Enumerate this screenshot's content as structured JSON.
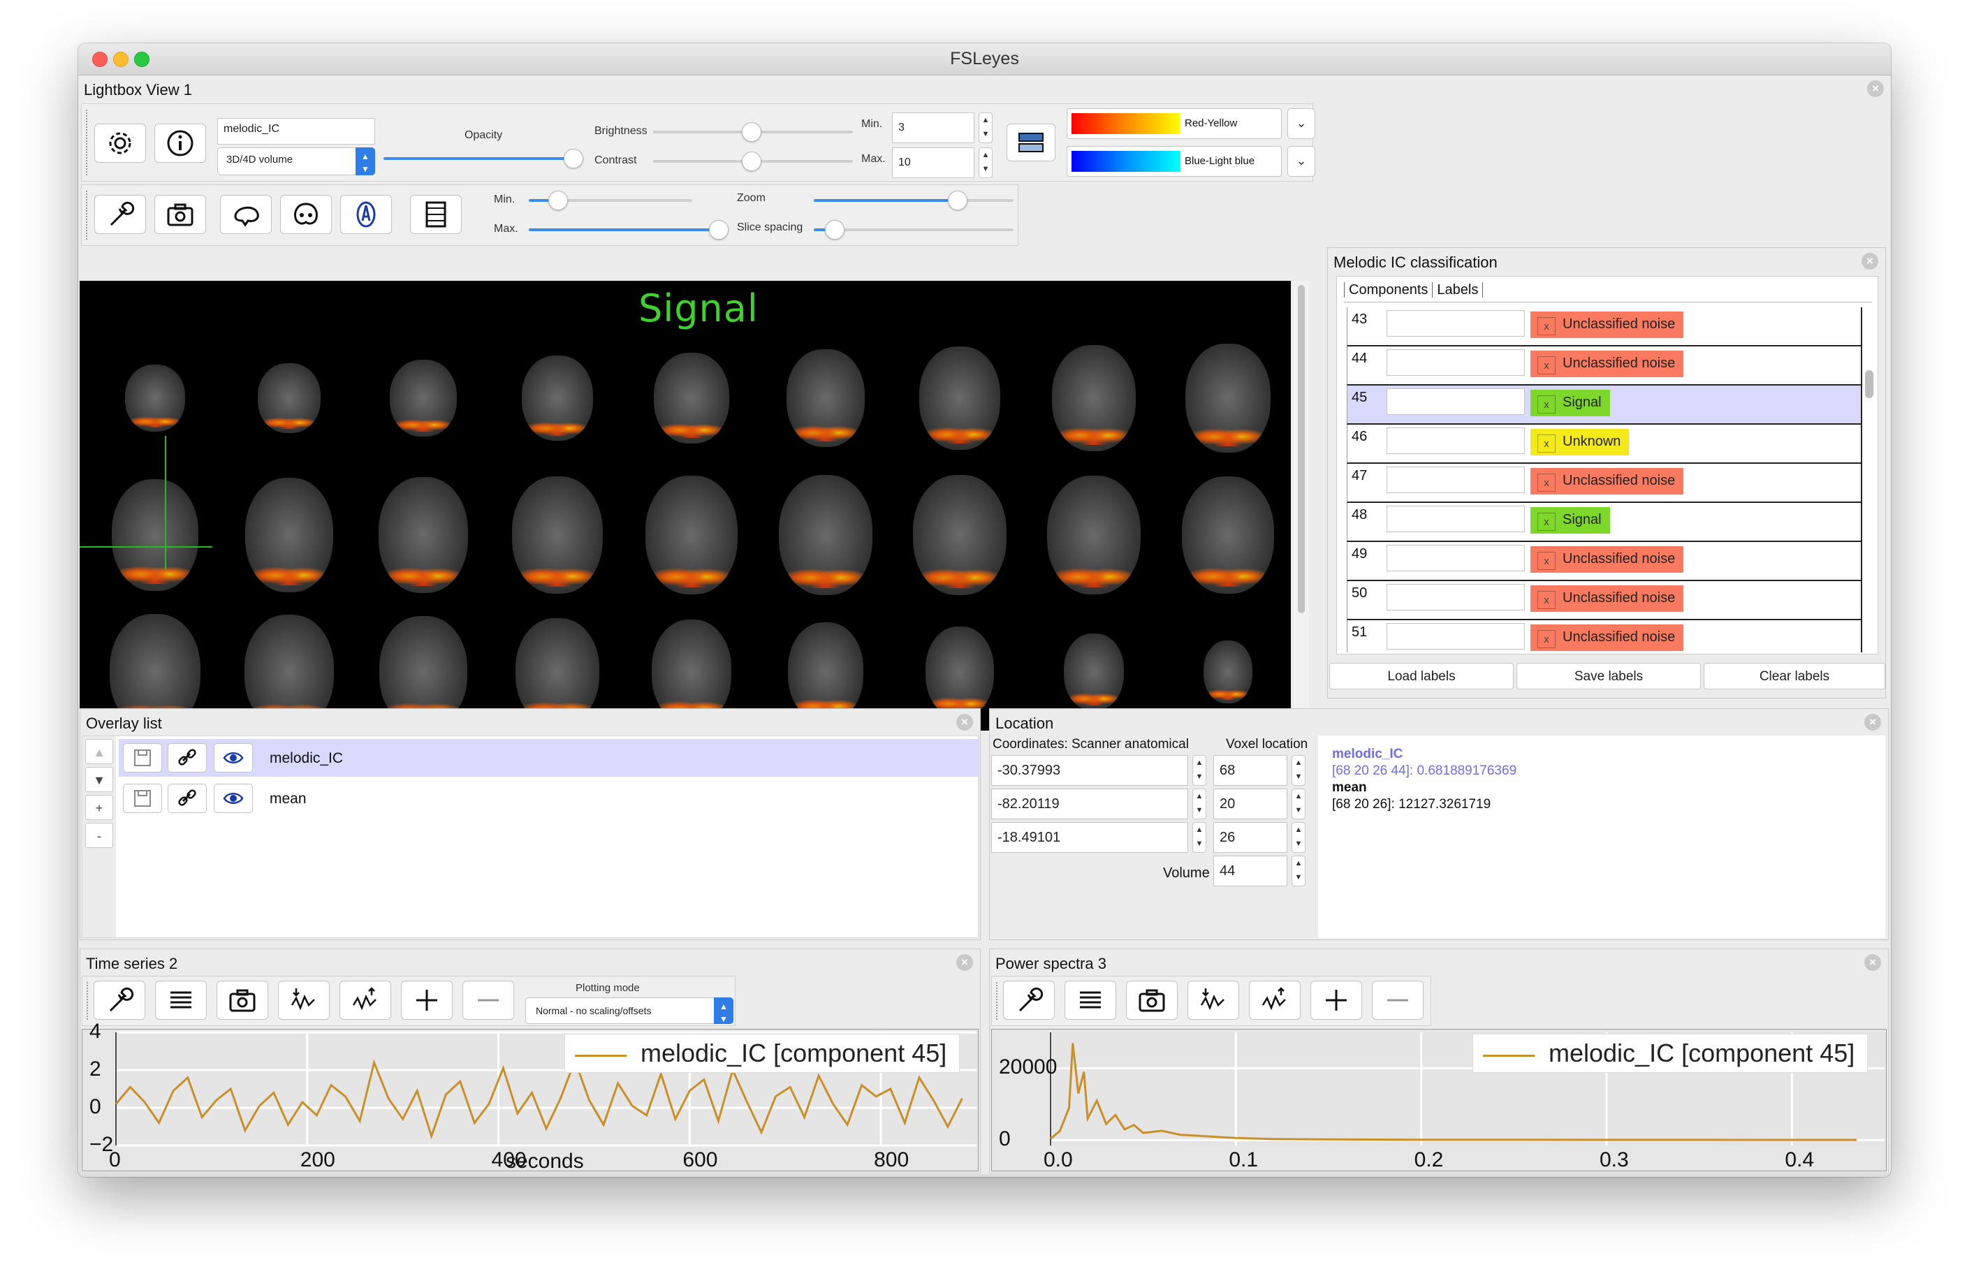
{
  "window": {
    "title": "FSLeyes"
  },
  "lightbox": {
    "title": "Lightbox View 1",
    "overlay_name": "melodic_IC",
    "overlay_type": "3D/4D volume",
    "opacity_label": "Opacity",
    "brightness_label": "Brightness",
    "contrast_label": "Contrast",
    "min_label": "Min.",
    "max_label": "Max.",
    "min_value": "3",
    "max_value": "10",
    "cmap_pos": "Red-Yellow",
    "cmap_neg": "Blue-Light blue",
    "slice_min_label": "Min.",
    "slice_max_label": "Max.",
    "zoom_label": "Zoom",
    "spacing_label": "Slice spacing",
    "canvas_label": "Signal"
  },
  "melodic": {
    "title": "Melodic IC classification",
    "tab_components": "Components",
    "tab_labels": "Labels",
    "rows": [
      {
        "num": "43",
        "label": "Unclassified noise",
        "color": "#f97a5e",
        "selected": false
      },
      {
        "num": "44",
        "label": "Unclassified noise",
        "color": "#f97a5e",
        "selected": false
      },
      {
        "num": "45",
        "label": "Signal",
        "color": "#7ed82a",
        "selected": true
      },
      {
        "num": "46",
        "label": "Unknown",
        "color": "#f4ea1a",
        "selected": false
      },
      {
        "num": "47",
        "label": "Unclassified noise",
        "color": "#f97a5e",
        "selected": false
      },
      {
        "num": "48",
        "label": "Signal",
        "color": "#7ed82a",
        "selected": false
      },
      {
        "num": "49",
        "label": "Unclassified noise",
        "color": "#f97a5e",
        "selected": false
      },
      {
        "num": "50",
        "label": "Unclassified noise",
        "color": "#f97a5e",
        "selected": false
      },
      {
        "num": "51",
        "label": "Unclassified noise",
        "color": "#f97a5e",
        "selected": false
      }
    ],
    "load_label": "Load labels",
    "save_label": "Save labels",
    "clear_label": "Clear labels"
  },
  "overlay_list": {
    "title": "Overlay list",
    "items": [
      {
        "name": "melodic_IC",
        "selected": true
      },
      {
        "name": "mean",
        "selected": false
      }
    ],
    "add_btn": "+",
    "remove_btn": "-"
  },
  "location": {
    "title": "Location",
    "coords_label": "Coordinates: Scanner anatomical",
    "voxel_label": "Voxel location",
    "volume_label": "Volume",
    "coords": [
      "-30.37993",
      "-82.20119",
      "-18.49101"
    ],
    "voxels": [
      "68",
      "20",
      "26"
    ],
    "volume": "44",
    "info_overlay": "melodic_IC",
    "info_overlay_value": "[68 20 26 44]: 0.681889176369",
    "info_mean": "mean",
    "info_mean_value": "[68 20 26]: 12127.3261719"
  },
  "timeseries": {
    "title": "Time series 2",
    "plotting_mode_label": "Plotting mode",
    "plotting_mode_value": "Normal - no scaling/offsets",
    "legend": "melodic_IC [component 45]",
    "xlabel": "seconds",
    "x_ticks": [
      "0",
      "200",
      "400",
      "600",
      "800"
    ],
    "y_ticks": [
      "4",
      "2",
      "0",
      "−2"
    ]
  },
  "powerspectra": {
    "title": "Power spectra 3",
    "legend": "melodic_IC [component 45]",
    "x_ticks": [
      "0.0",
      "0.1",
      "0.2",
      "0.3",
      "0.4"
    ],
    "y_ticks": [
      "20000",
      "0"
    ]
  },
  "chart_data": [
    {
      "type": "line",
      "series": [
        {
          "name": "melodic_IC [component 45]",
          "color": "#c9902a"
        }
      ],
      "xlabel": "seconds",
      "xlim": [
        0,
        900
      ],
      "ylim": [
        -2,
        4
      ],
      "x_ticks": [
        0,
        200,
        400,
        600,
        800
      ],
      "y_ticks": [
        4,
        2,
        0,
        -2
      ],
      "grid": true,
      "legend": "top-right",
      "x": [
        0,
        15,
        30,
        45,
        60,
        75,
        90,
        105,
        120,
        135,
        150,
        165,
        180,
        195,
        210,
        225,
        240,
        255,
        270,
        285,
        300,
        315,
        330,
        345,
        360,
        375,
        390,
        405,
        420,
        435,
        450,
        465,
        480,
        495,
        510,
        525,
        540,
        555,
        570,
        585,
        600,
        615,
        630,
        645,
        660,
        675,
        690,
        705,
        720,
        735,
        750,
        765,
        780,
        795,
        810,
        825,
        840,
        855,
        870,
        885
      ],
      "y": [
        0.2,
        1.1,
        0.3,
        -0.8,
        0.9,
        1.6,
        -0.5,
        0.4,
        1.0,
        -1.2,
        0.1,
        0.8,
        -0.9,
        0.3,
        -0.4,
        1.2,
        0.6,
        -0.7,
        2.4,
        0.5,
        -0.6,
        0.9,
        -1.5,
        0.7,
        1.4,
        -0.8,
        0.2,
        2.1,
        -0.3,
        0.8,
        -1.1,
        0.5,
        2.5,
        0.4,
        -0.9,
        1.3,
        0.1,
        -0.4,
        1.8,
        -0.6,
        0.9,
        1.5,
        -0.7,
        2.0,
        0.3,
        -1.3,
        0.6,
        1.1,
        -0.5,
        1.7,
        0.2,
        -0.9,
        1.2,
        0.6,
        1.0,
        -0.8,
        1.6,
        0.4,
        -1.0,
        0.5
      ]
    },
    {
      "type": "line",
      "series": [
        {
          "name": "melodic_IC [component 45]",
          "color": "#c9902a"
        }
      ],
      "xlim": [
        0,
        0.45
      ],
      "ylim": [
        -1500,
        30000
      ],
      "x_ticks": [
        0.0,
        0.1,
        0.2,
        0.3,
        0.4
      ],
      "y_ticks": [
        20000,
        0
      ],
      "grid": true,
      "legend": "top-right",
      "x": [
        0.0,
        0.005,
        0.01,
        0.012,
        0.015,
        0.018,
        0.02,
        0.025,
        0.03,
        0.035,
        0.04,
        0.045,
        0.05,
        0.06,
        0.07,
        0.08,
        0.09,
        0.1,
        0.12,
        0.15,
        0.2,
        0.25,
        0.3,
        0.35,
        0.4,
        0.435
      ],
      "y": [
        400,
        2500,
        9000,
        27000,
        13000,
        19000,
        6000,
        11000,
        4500,
        7000,
        3000,
        4200,
        2000,
        2600,
        1500,
        1200,
        900,
        600,
        300,
        200,
        120,
        90,
        80,
        70,
        60,
        50
      ]
    }
  ]
}
